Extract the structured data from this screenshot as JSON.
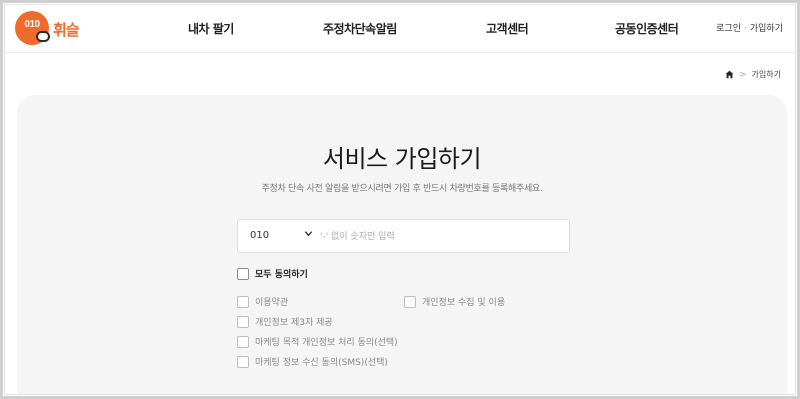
{
  "logo": {
    "badge_text": "010",
    "word": "휘슬"
  },
  "nav": {
    "items": [
      "내차 팔기",
      "주정차단속알림",
      "고객센터",
      "공동인증센터"
    ]
  },
  "auth": {
    "login": "로그인",
    "separator": "·",
    "signup": "가입하기"
  },
  "breadcrumb": {
    "home_icon": "home-icon",
    "separator": ">",
    "current": "가입하기"
  },
  "page": {
    "title": "서비스 가입하기",
    "subtitle": "주정차 단속 사전 알림을 받으시려면 가입 후 반드시 차량번호를 등록해주세요."
  },
  "phone": {
    "prefix": "010",
    "placeholder": "'-' 없이 숫자만 입력",
    "value": ""
  },
  "agreements": {
    "all": "모두 동의하기",
    "items": [
      "이용약관",
      "개인정보 수집 및 이용",
      "개인정보 제3자 제공",
      "마케팅 목적 개인정보 처리 동의(선택)",
      "마케팅 정보 수신 동의(SMS)(선택)"
    ]
  },
  "colors": {
    "brand": "#ef6a2b",
    "card_bg": "#f5f5f5",
    "text": "#222222"
  }
}
